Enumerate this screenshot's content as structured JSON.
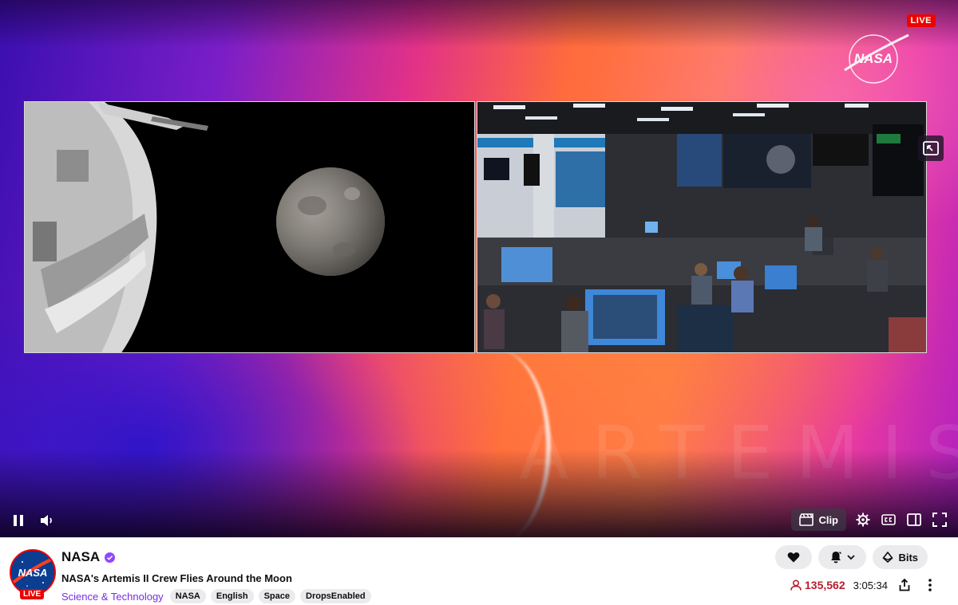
{
  "player": {
    "live_badge": "LIVE",
    "background_word": "ARTEMIS",
    "logo_text": "NASA",
    "controls": {
      "clip_label": "Clip",
      "icons": [
        "pause-icon",
        "volume-icon",
        "clip-icon",
        "settings-gear-icon",
        "closed-captions-icon",
        "theatre-mode-icon",
        "fullscreen-icon",
        "picture-in-picture-icon"
      ]
    }
  },
  "channel": {
    "name": "NASA",
    "avatar_text": "NASA",
    "avatar_live": "LIVE",
    "stream_title": "NASA's Artemis II Crew Flies Around the Moon",
    "category": "Science & Technology",
    "tags": [
      "NASA",
      "English",
      "Space",
      "DropsEnabled"
    ]
  },
  "actions": {
    "bits_label": "Bits"
  },
  "stats": {
    "viewers": "135,562",
    "uptime": "3:05:34"
  },
  "colors": {
    "live_red": "#eb0400",
    "brand_purple": "#772ce8",
    "viewer_red": "#b81d2d"
  }
}
